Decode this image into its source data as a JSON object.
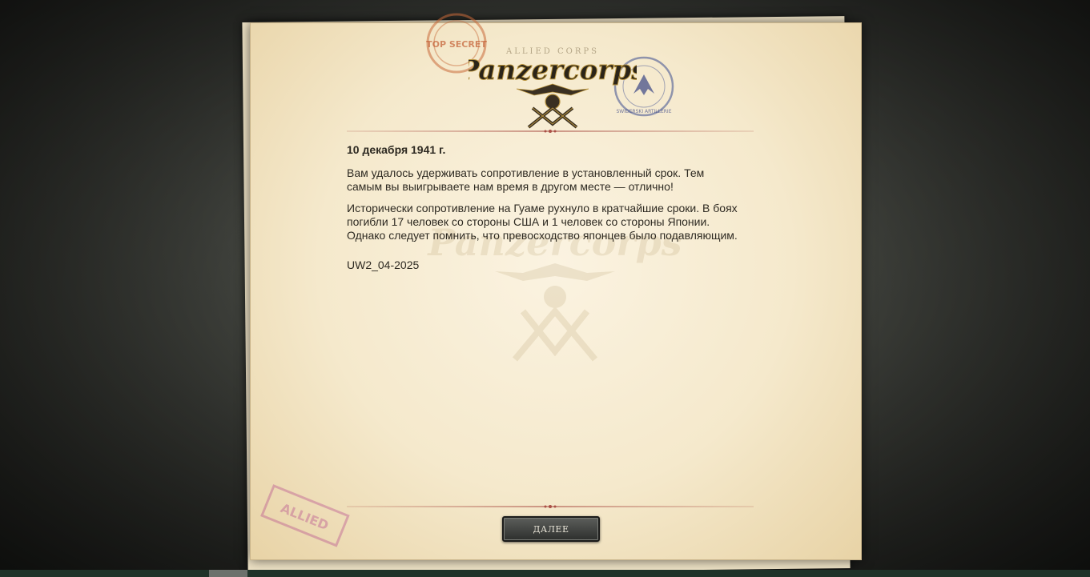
{
  "logo": {
    "title": "Panzercorps",
    "subtitle": "ALLIED CORPS"
  },
  "stamps": {
    "left": "TOP SECRET",
    "right": "SWIDERSKI ARTILLERIE",
    "bottom": "ALLIED"
  },
  "briefing": {
    "date": "10 декабря 1941 г.",
    "paragraph1": "Вам удалось удерживать сопротивление в установленный срок. Тем самым вы выигрываете нам время в другом месте — отлично!",
    "paragraph2": "Исторически сопротивление на Гуаме рухнуло в кратчайшие сроки. В боях погибли 17 человек со стороны США и 1 человек со стороны Японии. Однако следует помнить, что превосходство японцев было подавляющим.",
    "code": "UW2_04-2025"
  },
  "buttons": {
    "next": "ДАЛЕЕ"
  },
  "colors": {
    "paper": "#f5e9cc",
    "rule": "#aa5046",
    "button": "#3e403d",
    "text": "#2e2a22"
  }
}
